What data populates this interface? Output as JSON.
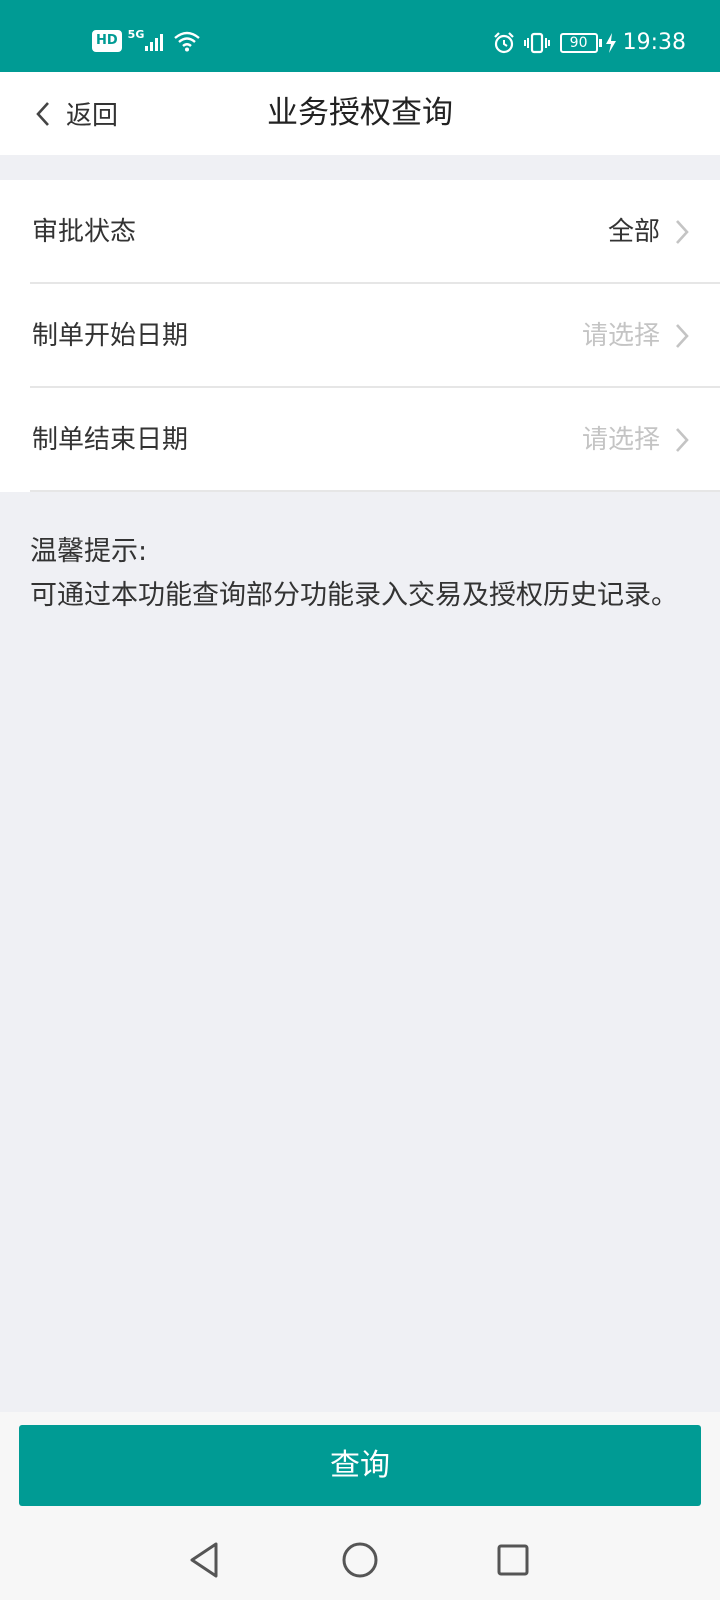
{
  "status_bar": {
    "hd_badge": "HD",
    "network": "5G",
    "battery_level": "90",
    "time": "19:38",
    "background_color": "#009b94",
    "icons": [
      "signal-icon",
      "wifi-icon",
      "alarm-icon",
      "vibrate-icon",
      "battery-icon",
      "charging-icon"
    ]
  },
  "nav": {
    "back_label": "返回",
    "title": "业务授权查询"
  },
  "form": {
    "rows": [
      {
        "label": "审批状态",
        "value": "全部",
        "is_placeholder": false
      },
      {
        "label": "制单开始日期",
        "value": "请选择",
        "is_placeholder": true
      },
      {
        "label": "制单结束日期",
        "value": "请选择",
        "is_placeholder": true
      }
    ]
  },
  "tip": {
    "title": "温馨提示:",
    "text": "可通过本功能查询部分功能录入交易及授权历史记录。"
  },
  "actions": {
    "query_label": "查询",
    "accent_color": "#009b94"
  },
  "system_nav": {
    "icons": [
      "back-triangle-icon",
      "home-circle-icon",
      "recent-square-icon"
    ]
  }
}
